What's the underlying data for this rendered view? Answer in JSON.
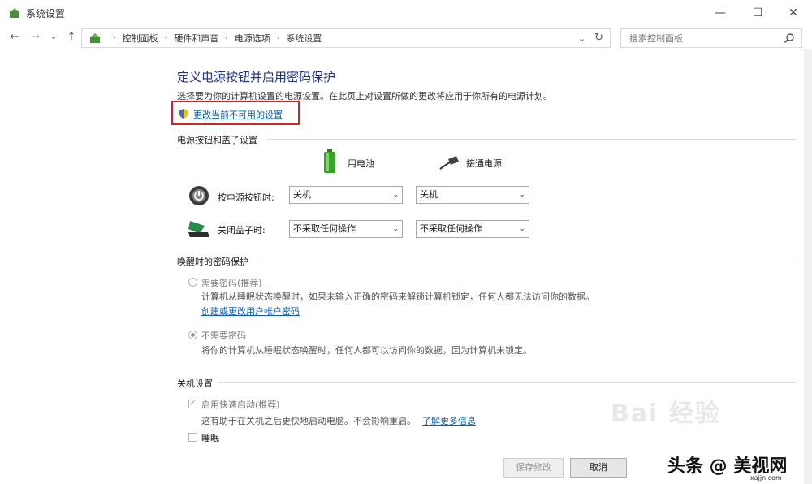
{
  "window": {
    "title": "系统设置",
    "min_glyph": "—",
    "max_glyph": "☐",
    "close_glyph": "✕"
  },
  "nav": {
    "back_glyph": "←",
    "forward_glyph": "→",
    "recent_glyph": "⌄",
    "up_glyph": "↑",
    "breadcrumbs": [
      "控制面板",
      "硬件和声音",
      "电源选项",
      "系统设置"
    ],
    "search_placeholder": "搜索控制面板"
  },
  "main": {
    "heading": "定义电源按钮并启用密码保护",
    "description": "选择要为你的计算机设置的电源设置。在此页上对设置所做的更改将应用于你所有的电源计划。",
    "change_link": "更改当前不可用的设置",
    "power_section": {
      "title": "电源按钮和盖子设置",
      "battery_label": "用电池",
      "plugged_label": "接通电源",
      "rows": [
        {
          "label": "按电源按钮时:",
          "battery_value": "关机",
          "plugged_value": "关机"
        },
        {
          "label": "关闭盖子时:",
          "battery_value": "不采取任何操作",
          "plugged_value": "不采取任何操作"
        }
      ]
    },
    "password_section": {
      "title": "唤醒时的密码保护",
      "require_label": "需要密码(推荐)",
      "require_desc": "计算机从睡眠状态唤醒时，如果未输入正确的密码来解锁计算机锁定，任何人都无法访问你的数据。",
      "create_link": "创建或更改用户帐户密码",
      "no_require_label": "不需要密码",
      "no_require_desc": "将你的计算机从睡眠状态唤醒时，任何人都可以访问你的数据，因为计算机未锁定。"
    },
    "shutdown_section": {
      "title": "关机设置",
      "fast_startup_label": "启用快速启动(推荐)",
      "fast_startup_desc": "这有助于在关机之后更快地启动电脑。不会影响重启。",
      "learn_more": "了解更多信息",
      "sleep_label": "睡眠"
    },
    "save_button": "保存修改",
    "cancel_button": "取消"
  },
  "overlay": {
    "watermark": "Bai 经验",
    "brand": "头条 @ 美视网",
    "brand_sub": "xajjn.com"
  },
  "colors": {
    "heading": "#1e3287",
    "link": "#0b5ea8",
    "highlight_box": "#d8202a"
  }
}
